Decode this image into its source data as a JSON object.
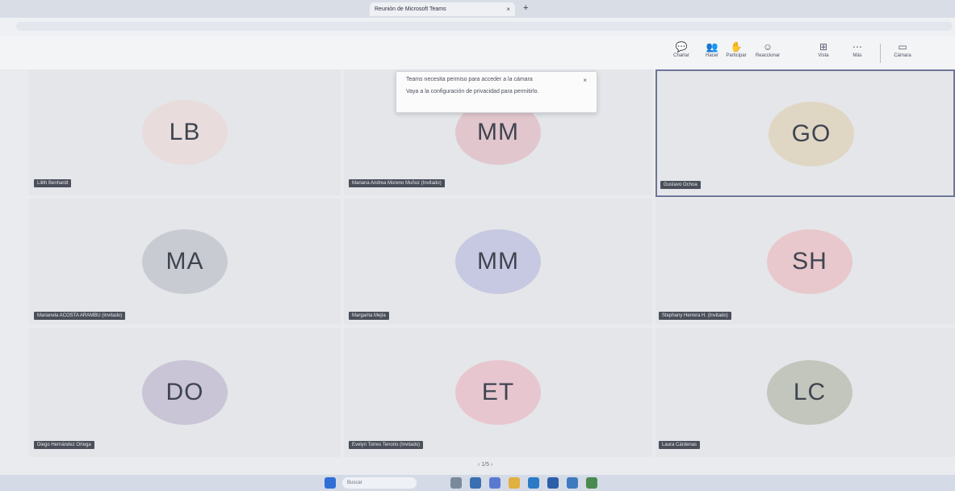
{
  "browser": {
    "tabs": [
      {
        "label": "",
        "active": false
      },
      {
        "label": "",
        "active": false
      },
      {
        "label": "Reunión de Microsoft Teams",
        "active": true
      }
    ],
    "new_tab": "+",
    "close_tab": "×",
    "url": ""
  },
  "toolbar": {
    "items": [
      {
        "label": "Charlar",
        "icon": "chat-icon"
      },
      {
        "label": "Hacer",
        "icon": "people-icon"
      },
      {
        "label": "Participar",
        "icon": "raise-hand-icon"
      },
      {
        "label": "Reaccionar",
        "icon": "emoji-icon"
      },
      {
        "label": "Vista",
        "icon": "grid-icon"
      },
      {
        "label": "Más",
        "icon": "more-icon"
      },
      {
        "label": "Cámara",
        "icon": "camera-icon"
      }
    ]
  },
  "notification": {
    "line1": "Teams necesita permiso para acceder a la cámara",
    "line2": "Vaya a la configuración de privacidad para permitirlo.",
    "close": "×"
  },
  "participants": [
    {
      "initials": "LB",
      "color": "#e8dcdd",
      "name": "Lilith Benhardt"
    },
    {
      "initials": "MM",
      "color": "#e2c6cd",
      "name": "Mariana Andrea Moreno Muñoz (Invitado)"
    },
    {
      "initials": "GO",
      "color": "#e0d6c4",
      "name": "Gustavo Ochoa"
    },
    {
      "initials": "MA",
      "color": "#c8ccd2",
      "name": "Marianela ACOSTA ARAMBU (Invitado)"
    },
    {
      "initials": "MM",
      "color": "#c7c9e2",
      "name": "Margarita Mejía"
    },
    {
      "initials": "SH",
      "color": "#e8c8cc",
      "name": "Stephany Herrera H. (Invitado)"
    },
    {
      "initials": "DO",
      "color": "#c9c4d6",
      "name": "Diego Hernández Ortega"
    },
    {
      "initials": "ET",
      "color": "#e8c6d0",
      "name": "Evelyn Torres Tenorio (Invitado)"
    },
    {
      "initials": "LC",
      "color": "#c3c6bd",
      "name": "Laura Cárdenas"
    }
  ],
  "pager": "‹  1/5  ›",
  "taskbar": {
    "search_placeholder": "Buscar"
  }
}
